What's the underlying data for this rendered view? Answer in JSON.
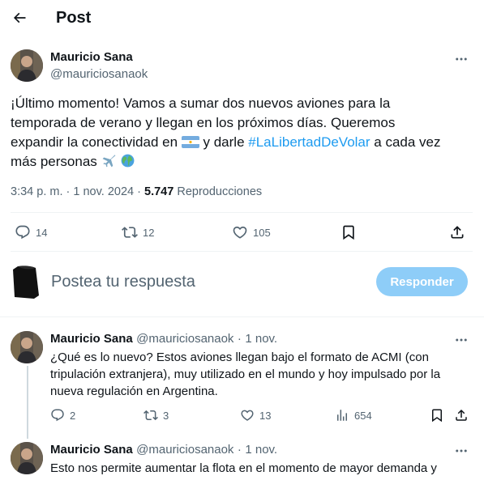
{
  "header": {
    "title": "Post",
    "back_icon": "arrow-left-icon"
  },
  "main_post": {
    "author_name": "Mauricio Sana",
    "author_handle": "@mauriciosanaok",
    "text_part1": "¡Último momento! Vamos a sumar dos nuevos aviones para la temporada de verano y llegan en los próximos días. Queremos expandir la conectividad en",
    "text_part2": "y darle",
    "hashtag": "#LaLibertadDeVolar",
    "text_part3": "a cada vez más personas",
    "time": "3:34 p. m.",
    "separator": "·",
    "date": "1 nov. 2024",
    "views": "5.747",
    "views_label": "Reproducciones",
    "replies_count": "14",
    "reposts_count": "12",
    "likes_count": "105"
  },
  "composer": {
    "placeholder": "Postea tu respuesta",
    "button_label": "Responder"
  },
  "replies": [
    {
      "author_name": "Mauricio Sana",
      "author_handle": "@mauriciosanaok",
      "separator": "·",
      "date": "1 nov.",
      "text": "¿Qué es lo nuevo? Estos aviones llegan bajo el formato de ACMI (con tripulación extranjera), muy utilizado en el mundo y hoy impulsado por la nueva regulación en Argentina.",
      "replies_count": "2",
      "reposts_count": "3",
      "likes_count": "13",
      "views_count": "654"
    },
    {
      "author_name": "Mauricio Sana",
      "author_handle": "@mauriciosanaok",
      "separator": "·",
      "date": "1 nov.",
      "text": "Esto nos permite aumentar la flota en el momento de mayor demanda y"
    }
  ],
  "colors": {
    "accent": "#1d9bf0",
    "reply_button": "#8ecdf8",
    "secondary_text": "#536471",
    "divider": "#eff3f4"
  }
}
